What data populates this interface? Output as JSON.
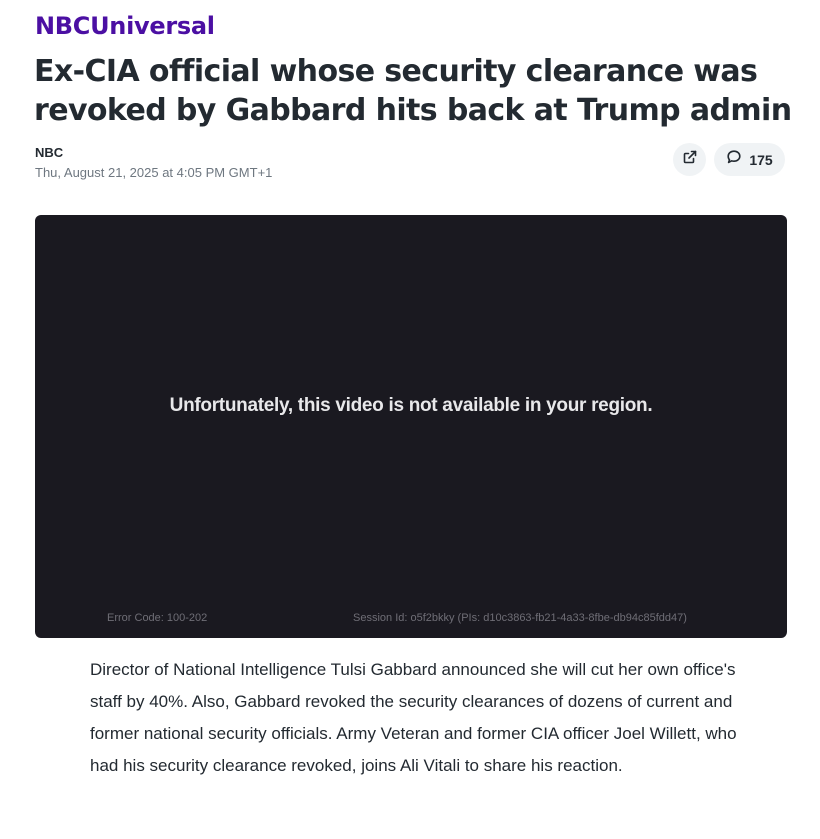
{
  "brand": {
    "name": "NBCUniversal",
    "color": "#4b0fa3"
  },
  "article": {
    "headline": "Ex-CIA official whose security clearance was revoked by Gabbard hits back at Trump admin",
    "source": "NBC",
    "timestamp": "Thu, August 21, 2025 at 4:05 PM GMT+1",
    "summary": "Director of National Intelligence Tulsi Gabbard announced she will cut her own office's staff by 40%. Also, Gabbard revoked the security clearances of dozens of current and former national security officials. Army Veteran and former CIA officer Joel Willett, who had his security clearance revoked, joins Ali Vitali to share his reaction."
  },
  "actions": {
    "share_icon": "external-link-icon",
    "comment_icon": "speech-bubble-icon",
    "comment_count": "175"
  },
  "video": {
    "background_color": "#1a1920",
    "message": "Unfortunately, this video is not available in your region.",
    "error_code": "Error Code: 100-202",
    "session_id": "Session Id: o5f2bkky (PIs: d10c3863-fb21-4a33-8fbe-db94c85fdd47)"
  }
}
